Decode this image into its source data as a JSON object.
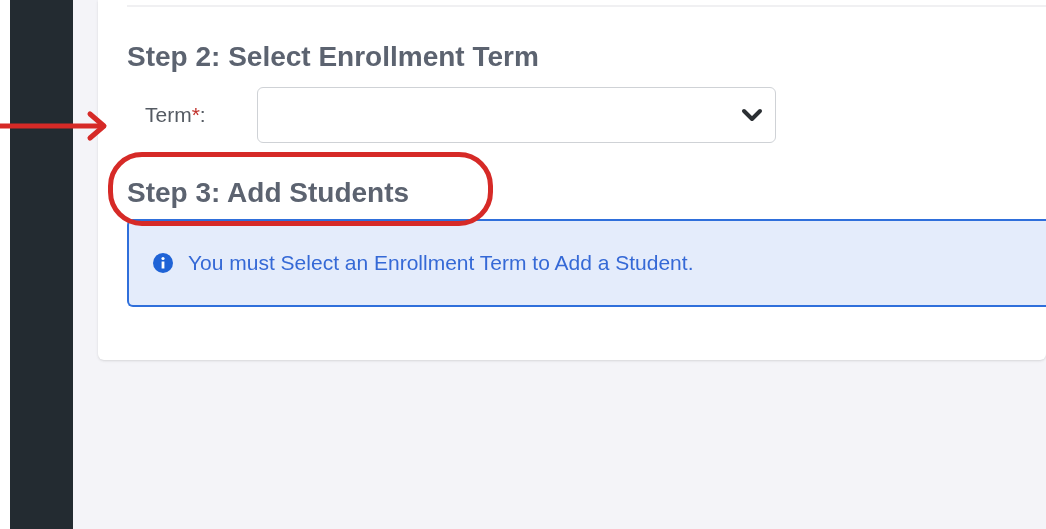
{
  "steps": [
    {
      "kind": "select_step",
      "title": "Step 2: Select Enrollment Term",
      "field": {
        "label": "Term",
        "required_mark": "*",
        "label_suffix": ":",
        "arrow_marked": true
      }
    },
    {
      "kind": "alert_step",
      "title": "Step 3: Add Students",
      "heading_circled": true,
      "alert": {
        "message": "You must Select an Enrollment Term to Add a Student."
      }
    }
  ]
}
